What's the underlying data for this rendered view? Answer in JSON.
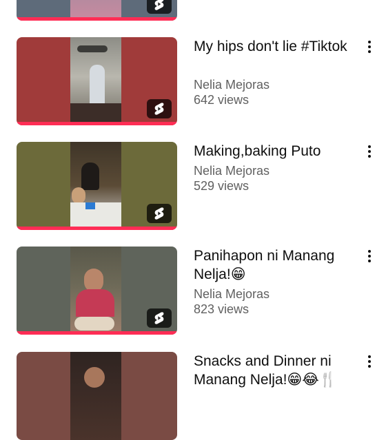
{
  "colors": {
    "progress": "#ff2d55",
    "title": "#0f0f0f",
    "meta": "#606060"
  },
  "videos": [
    {
      "title": "",
      "channel": "",
      "views": "",
      "thumb_bg": "#5e6b7a",
      "badge_icon": "shorts-icon"
    },
    {
      "title": "My hips don't lie #Tiktok",
      "channel": "Nelia Mejoras",
      "views": "642 views",
      "thumb_bg": "#a03b3a",
      "badge_icon": "shorts-icon"
    },
    {
      "title": "Making,baking Puto",
      "channel": "Nelia Mejoras",
      "views": "529 views",
      "thumb_bg": "#6c6a3a",
      "badge_icon": "shorts-icon"
    },
    {
      "title": "Panihapon ni Manang Nelja!😁",
      "channel": "Nelia Mejoras",
      "views": "823 views",
      "thumb_bg": "#5f645b",
      "badge_icon": "shorts-icon"
    },
    {
      "title": "Snacks and Dinner ni Manang Nelja!😁😂🍴",
      "channel": "",
      "views": "",
      "thumb_bg": "#7a4b44",
      "badge_icon": "shorts-icon"
    }
  ],
  "menu_icon": "more-vertical-icon"
}
